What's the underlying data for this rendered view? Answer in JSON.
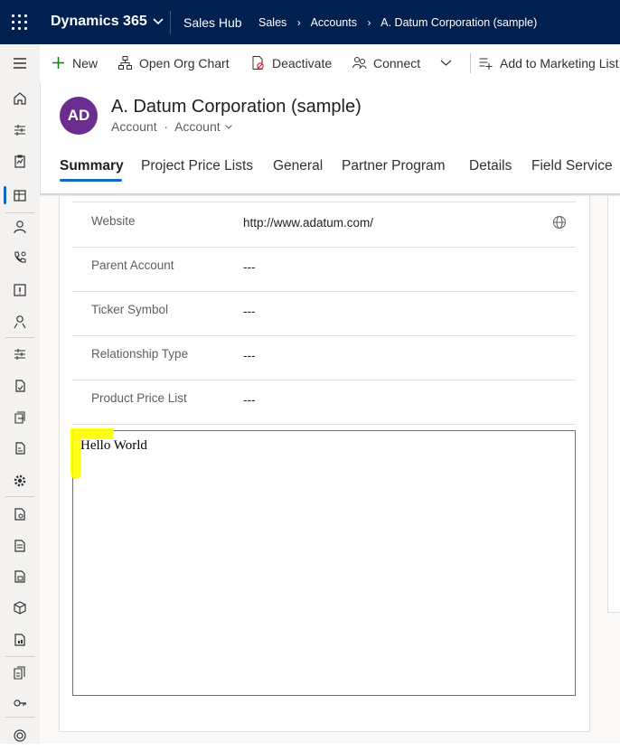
{
  "topbar": {
    "app_name": "Dynamics 365",
    "hub": "Sales Hub",
    "breadcrumbs": [
      "Sales",
      "Accounts",
      "A. Datum Corporation (sample)"
    ]
  },
  "commands": [
    {
      "label": "New",
      "icon": "plus-icon"
    },
    {
      "label": "Open Org Chart",
      "icon": "org-chart-icon"
    },
    {
      "label": "Deactivate",
      "icon": "deactivate-icon"
    },
    {
      "label": "Connect",
      "icon": "connect-icon"
    },
    {
      "label": "Add to Marketing List",
      "icon": "add-list-icon"
    }
  ],
  "record": {
    "initials": "AD",
    "title": "A. Datum Corporation (sample)",
    "entity": "Account",
    "form": "Account",
    "avatar_color": "#6b2e8f"
  },
  "tabs": [
    "Summary",
    "Project Price Lists",
    "General",
    "Partner Program",
    "Details",
    "Field Service"
  ],
  "fields": [
    {
      "label": "Website",
      "value": "http://www.adatum.com/"
    },
    {
      "label": "Parent Account",
      "value": "---"
    },
    {
      "label": "Ticker Symbol",
      "value": "---"
    },
    {
      "label": "Relationship Type",
      "value": "---"
    },
    {
      "label": "Product Price List",
      "value": "---"
    }
  ],
  "web_resource": {
    "text": "Hello World"
  },
  "colors": {
    "topbar": "#002050",
    "accent": "#0f6cbd",
    "highlight": "#ffff00"
  }
}
